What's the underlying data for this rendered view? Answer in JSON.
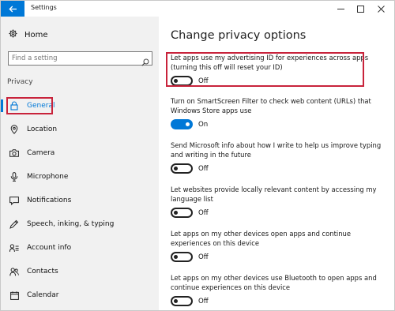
{
  "window": {
    "title": "Settings"
  },
  "sidebar": {
    "home_label": "Home",
    "search_placeholder": "Find a setting",
    "section_label": "Privacy",
    "items": [
      {
        "label": "General",
        "icon": "lock-icon",
        "selected": true
      },
      {
        "label": "Location",
        "icon": "location-icon"
      },
      {
        "label": "Camera",
        "icon": "camera-icon"
      },
      {
        "label": "Microphone",
        "icon": "microphone-icon"
      },
      {
        "label": "Notifications",
        "icon": "notifications-icon"
      },
      {
        "label": "Speech, inking, & typing",
        "icon": "speech-icon"
      },
      {
        "label": "Account info",
        "icon": "account-icon"
      },
      {
        "label": "Contacts",
        "icon": "contacts-icon"
      },
      {
        "label": "Calendar",
        "icon": "calendar-icon"
      }
    ]
  },
  "main": {
    "title": "Change privacy options",
    "options": [
      {
        "desc": "Let apps use my advertising ID for experiences across apps (turning this off will reset your ID)",
        "state": "Off"
      },
      {
        "desc": "Turn on SmartScreen Filter to check web content (URLs) that Windows Store apps use",
        "state": "On"
      },
      {
        "desc": "Send Microsoft info about how I write to help us improve typing and writing in the future",
        "state": "Off"
      },
      {
        "desc": "Let websites provide locally relevant content by accessing my language list",
        "state": "Off"
      },
      {
        "desc": "Let apps on my other devices open apps and continue experiences on this device",
        "state": "Off"
      },
      {
        "desc": "Let apps on my other devices use Bluetooth to open apps and continue experiences on this device",
        "state": "Off"
      }
    ]
  },
  "colors": {
    "accent": "#0078d7",
    "highlight": "#c8233b",
    "sidebar_bg": "#f1f1f1"
  }
}
